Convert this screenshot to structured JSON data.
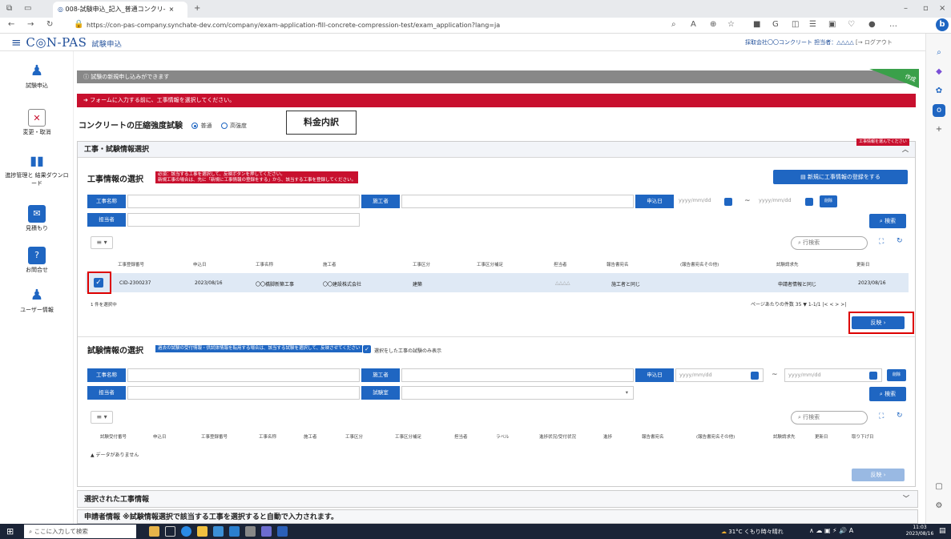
{
  "browser": {
    "tab_title": "008-試験申込_記入_普通コンクリ-",
    "url": "https://con-pas-company.synchate-dev.com/company/exam-application-fill-concrete-compression-test/exam_application?lang=ja"
  },
  "app": {
    "logo": "≡ C◎N-PAS",
    "page_title": "試験申込",
    "user_info": "採取会社〇〇コンクリート 担当者：△△△△",
    "logout_label": "ログアウト",
    "corner_badge": "作成"
  },
  "nav": {
    "items": [
      {
        "label": "試験申込",
        "icon": "person-icon"
      },
      {
        "label": "変更・取消",
        "icon": "document-cancel-icon"
      },
      {
        "label": "進捗管理と 結果ダウンロード",
        "icon": "bar-chart-icon"
      },
      {
        "label": "見積もり",
        "icon": "mail-icon"
      },
      {
        "label": "お問合せ",
        "icon": "question-icon"
      },
      {
        "label": "ユーザー情報",
        "icon": "user-icon"
      }
    ]
  },
  "notices": {
    "info": "試験の新規申し込みができます",
    "warning": "フォームに入力する前に、工事情報を選択してください。"
  },
  "test_type": {
    "title": "コンクリートの圧縮強度試験",
    "option_normal": "普通",
    "option_high": "高強度",
    "fee_button": "料金内訳"
  },
  "panel": {
    "title": "工事・試験情報選択",
    "alert_tag": "工事情報を選んでください"
  },
  "construction": {
    "section_title": "工事情報の選択",
    "hint_line1": "必須：該当する工事を選択して、反映ボタンを押してください。",
    "hint_line2": "新規工事の場合は、先に「新規に工事情報の登録をする」から、該当する工事を登録してください。",
    "register_button": "新規に工事情報の登録をする",
    "labels": {
      "name": "工事名称",
      "builder": "施工者",
      "date": "申込日",
      "staff": "担当者"
    },
    "date_placeholder_from": "yyyy/mm/dd",
    "date_placeholder_to": "yyyy/mm/dd",
    "clear_label": "削除",
    "search_button": "検索",
    "row_search_placeholder": "行検索",
    "columns": [
      "工事登録番号",
      "申込日",
      "工事名称",
      "施工者",
      "工事区分",
      "工事区分補足",
      "担当者",
      "報告書宛名",
      "(報告書宛名その他)",
      "試験請求先",
      "更新日"
    ],
    "rows": [
      [
        "CID-2300237",
        "2023/08/16",
        "〇〇橋脚新築工事",
        "〇〇建設株式会社",
        "建築",
        "",
        "△△△△",
        "施工者と同じ",
        "",
        "申請者情報と同じ",
        "2023/08/16"
      ]
    ],
    "selected_count": "1 件を選択中",
    "pagination": "ページあたりの件数 35 ▼  1-1/1  |<  <  >  >|",
    "reflect_button": "反映 ›"
  },
  "tests": {
    "section_title": "試験情報の選択",
    "hint": "過去の試験の受付情報・供試体情報を転用する場合は、該当する試験を選択して、反映させてください",
    "only_selected_label": "選択をした工事の試験のみ表示",
    "labels": {
      "name": "工事名称",
      "builder": "施工者",
      "date": "申込日",
      "staff": "担当者",
      "test_type": "試験室"
    },
    "date_placeholder_from": "yyyy/mm/dd",
    "date_placeholder_to": "yyyy/mm/dd",
    "clear_label": "削除",
    "search_button": "検索",
    "row_search_placeholder": "行検索",
    "columns": [
      "試験受付番号",
      "申込日",
      "工事登録番号",
      "工事名称",
      "施工者",
      "工事区分",
      "工事区分補足",
      "担当者",
      "ラベル",
      "進捗状況/受付状況",
      "進捗",
      "報告書宛名",
      "(報告書宛名その他)",
      "試験請求先",
      "更新日",
      "取り下げ日"
    ],
    "empty_message": "データがありません",
    "reflect_button": "反映 ›"
  },
  "collapsed": {
    "selected_construction": "選択された工事情報",
    "applicant": "申請者情報 ※試験情報選択で該当する工事を選択すると自動で入力されます。"
  },
  "taskbar": {
    "search_placeholder": "ここに入力して検索",
    "weather": "31°C くもり時々晴れ",
    "time": "11:03",
    "date": "2023/08/16"
  }
}
